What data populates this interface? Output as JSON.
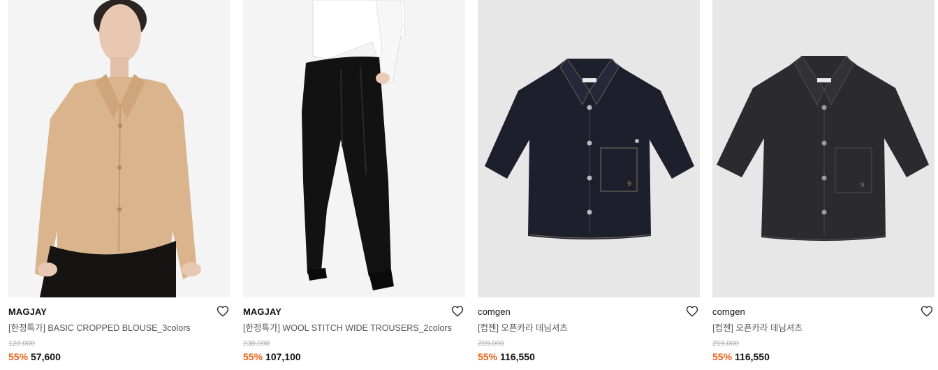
{
  "products": [
    {
      "brand": "MAGJAY",
      "name": "[한정특가] BASIC CROPPED BLOUSE_3colors",
      "original_price": "128,000",
      "discount": "55%",
      "price": "57,600",
      "image": "beige-blouse-model-photo"
    },
    {
      "brand": "MAGJAY",
      "name": "[한정특가] WOOL STITCH WIDE TROUSERS_2colors",
      "original_price": "238,000",
      "discount": "55%",
      "price": "107,100",
      "image": "black-wide-trousers-model-photo"
    },
    {
      "brand": "comgen",
      "name": "[컴젠] 오픈카라 데님셔츠",
      "original_price": "259,000",
      "discount": "55%",
      "price": "116,550",
      "image": "dark-indigo-denim-shirt-photo"
    },
    {
      "brand": "comgen",
      "name": "[컴젠] 오픈카라 데님셔츠",
      "original_price": "259,000",
      "discount": "55%",
      "price": "116,550",
      "image": "black-denim-shirt-photo"
    }
  ],
  "colors": {
    "discount": "#e8641b",
    "original_price": "#aaaaaa",
    "product_name": "#555555",
    "brand": "#111111"
  },
  "icons": {
    "wishlist": "heart-outline-icon"
  }
}
